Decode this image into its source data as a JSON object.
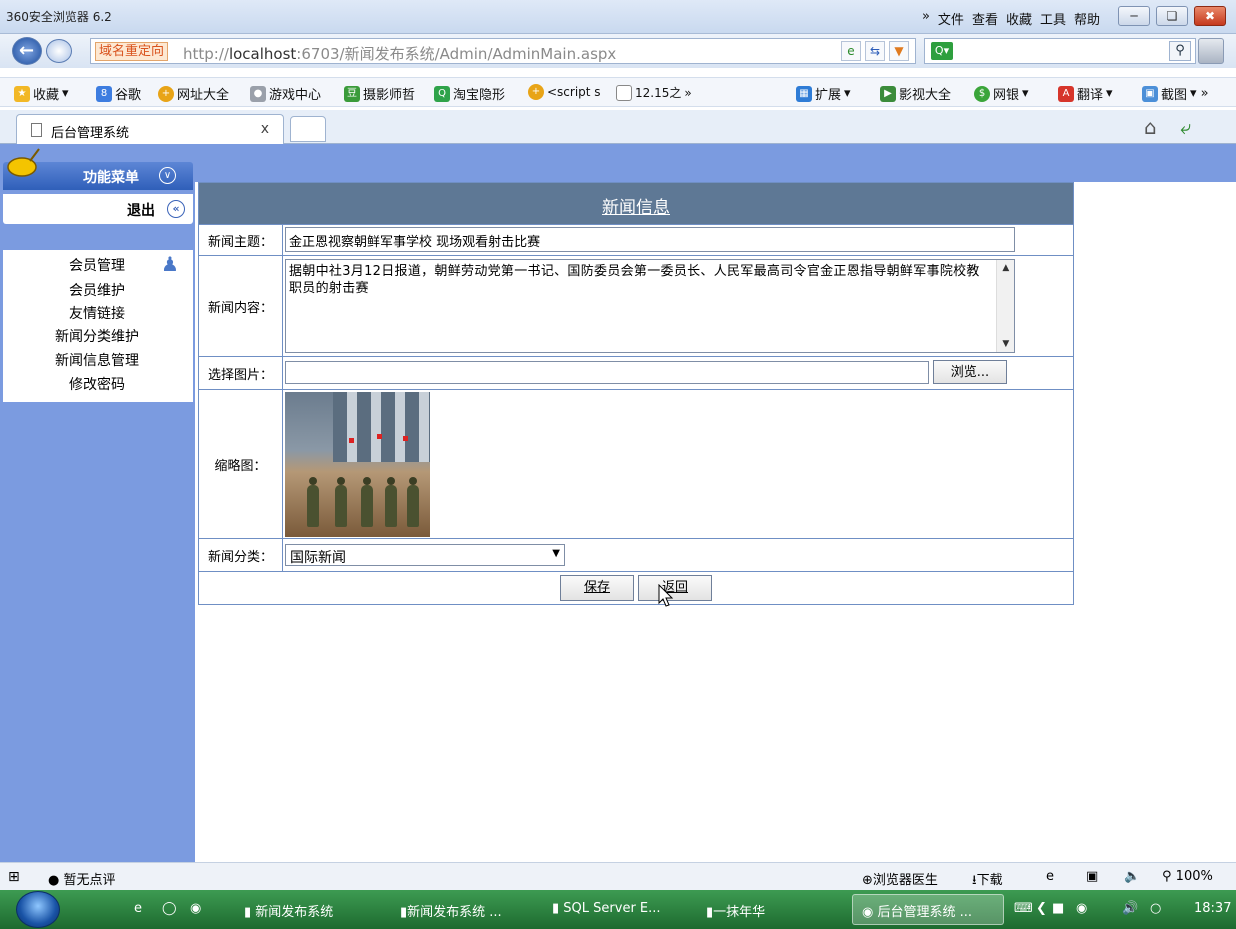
{
  "browser": {
    "title": "360安全浏览器 6.2",
    "menu": [
      "文件",
      "查看",
      "收藏",
      "工具",
      "帮助"
    ],
    "menu_more": "»",
    "address": {
      "redirect_label": "域名重定向",
      "url_prefix": "http://",
      "url_host": "localhost",
      "url_rest": ":6703/新闻发布系统/Admin/AdminMain.aspx"
    },
    "favorites": [
      "收藏",
      "谷歌",
      "网址大全",
      "游戏中心",
      "摄影师哲",
      "淘宝隐形",
      "<script s",
      "12.15之",
      "扩展",
      "影视大全",
      "网银",
      "翻译",
      "截图"
    ],
    "tab": {
      "label": "后台管理系统",
      "close": "x"
    }
  },
  "sidebar": {
    "menu_title": "功能菜单",
    "logout_label": "退出",
    "group_label": "会员管理",
    "items": [
      "会员维护",
      "友情链接",
      "新闻分类维护",
      "新闻信息管理",
      "修改密码"
    ]
  },
  "form": {
    "header": "新闻信息",
    "subject_label": "新闻主题：",
    "subject_value": "金正恩视察朝鲜军事学校 现场观看射击比赛",
    "content_label": "新闻内容：",
    "content_value": "据朝中社3月12日报道，朝鲜劳动党第一书记、国防委员会第一委员长、人民军最高司令官金正恩指导朝鲜军事院校教职员的射击赛",
    "image_label": "选择图片：",
    "browse_label": "浏览...",
    "thumb_label": "缩略图：",
    "category_label": "新闻分类：",
    "category_value": "国际新闻",
    "save_label": "保存",
    "back_label": "返回"
  },
  "statusbar": {
    "rating": "暂无点评",
    "doctor": "浏览器医生",
    "download": "下载",
    "zoom": "100%"
  },
  "taskbar": {
    "items": [
      "新闻发布系统",
      "新闻发布系统 ...",
      "SQL Server E...",
      "一抹年华",
      "后台管理系统 ..."
    ],
    "time": "18:37"
  }
}
